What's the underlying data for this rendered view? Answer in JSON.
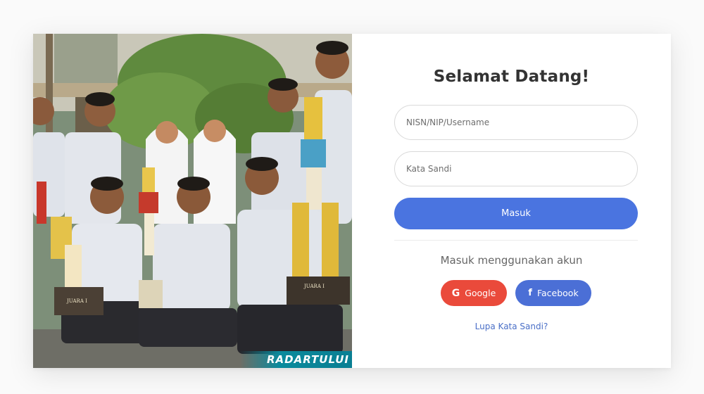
{
  "photo": {
    "watermark": "RADARTULUI",
    "trophy_plaques": [
      "JUARA I",
      "JUARA I"
    ]
  },
  "login": {
    "title": "Selamat Datang!",
    "username_placeholder": "NISN/NIP/Username",
    "password_placeholder": "Kata Sandi",
    "submit_label": "Masuk",
    "social_heading": "Masuk menggunakan akun",
    "google_label": "Google",
    "facebook_label": "Facebook",
    "google_icon": "G",
    "facebook_icon": "f",
    "forgot_label": "Lupa Kata Sandi?"
  },
  "colors": {
    "primary": "#4a74e0",
    "google": "#ea4a3b",
    "facebook": "#4b6fd6",
    "link": "#4a6fc7"
  }
}
